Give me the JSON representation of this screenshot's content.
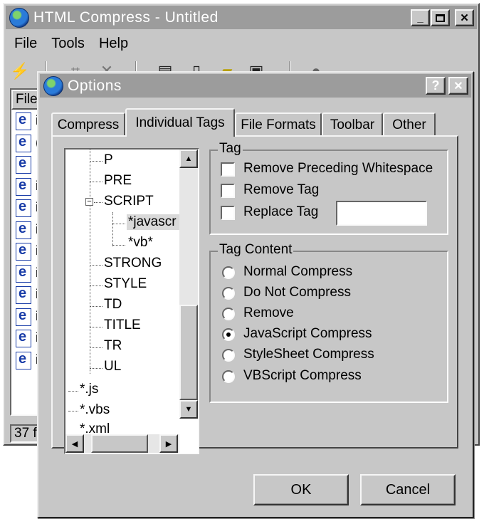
{
  "main_window": {
    "title": "HTML Compress - Untitled",
    "menu": [
      "File",
      "Tools",
      "Help"
    ],
    "toolbar_icons": [
      "lightning-icon",
      "wand-icon",
      "close-x-icon",
      "save-multiple-icon",
      "new-file-icon",
      "open-folder-icon",
      "save-icon",
      "help-icon"
    ],
    "list_header": "File",
    "file_rows": [
      "і",
      "(",
      "",
      "і",
      "і",
      "і",
      "і",
      "і",
      "і",
      "і",
      "і",
      "і"
    ],
    "status": "37 fil"
  },
  "dialog": {
    "title": "Options",
    "help_label": "?",
    "close_label": "✕",
    "tabs": [
      "Compress",
      "Individual Tags",
      "File Formats",
      "Toolbar",
      "Other"
    ],
    "active_tab": "Individual Tags",
    "tree": {
      "nodes": [
        "P",
        "PRE",
        "SCRIPT",
        "*javascr",
        "*vb*",
        "STRONG",
        "STYLE",
        "TD",
        "TITLE",
        "TR",
        "UL",
        "*.js",
        "*.vbs",
        "*.xml"
      ],
      "selected": "*javascr",
      "expanded": "SCRIPT"
    },
    "tag_group": {
      "legend": "Tag",
      "options": [
        {
          "label": "Remove Preceding Whitespace",
          "checked": false
        },
        {
          "label": "Remove Tag",
          "checked": false
        },
        {
          "label": "Replace Tag",
          "checked": false
        }
      ],
      "replace_value": ""
    },
    "content_group": {
      "legend": "Tag Content",
      "options": [
        {
          "label": "Normal Compress",
          "selected": false
        },
        {
          "label": "Do Not Compress",
          "selected": false
        },
        {
          "label": "Remove",
          "selected": false
        },
        {
          "label": "JavaScript Compress",
          "selected": true
        },
        {
          "label": "StyleSheet Compress",
          "selected": false
        },
        {
          "label": "VBScript Compress",
          "selected": false
        }
      ]
    },
    "buttons": {
      "ok": "OK",
      "cancel": "Cancel"
    }
  }
}
